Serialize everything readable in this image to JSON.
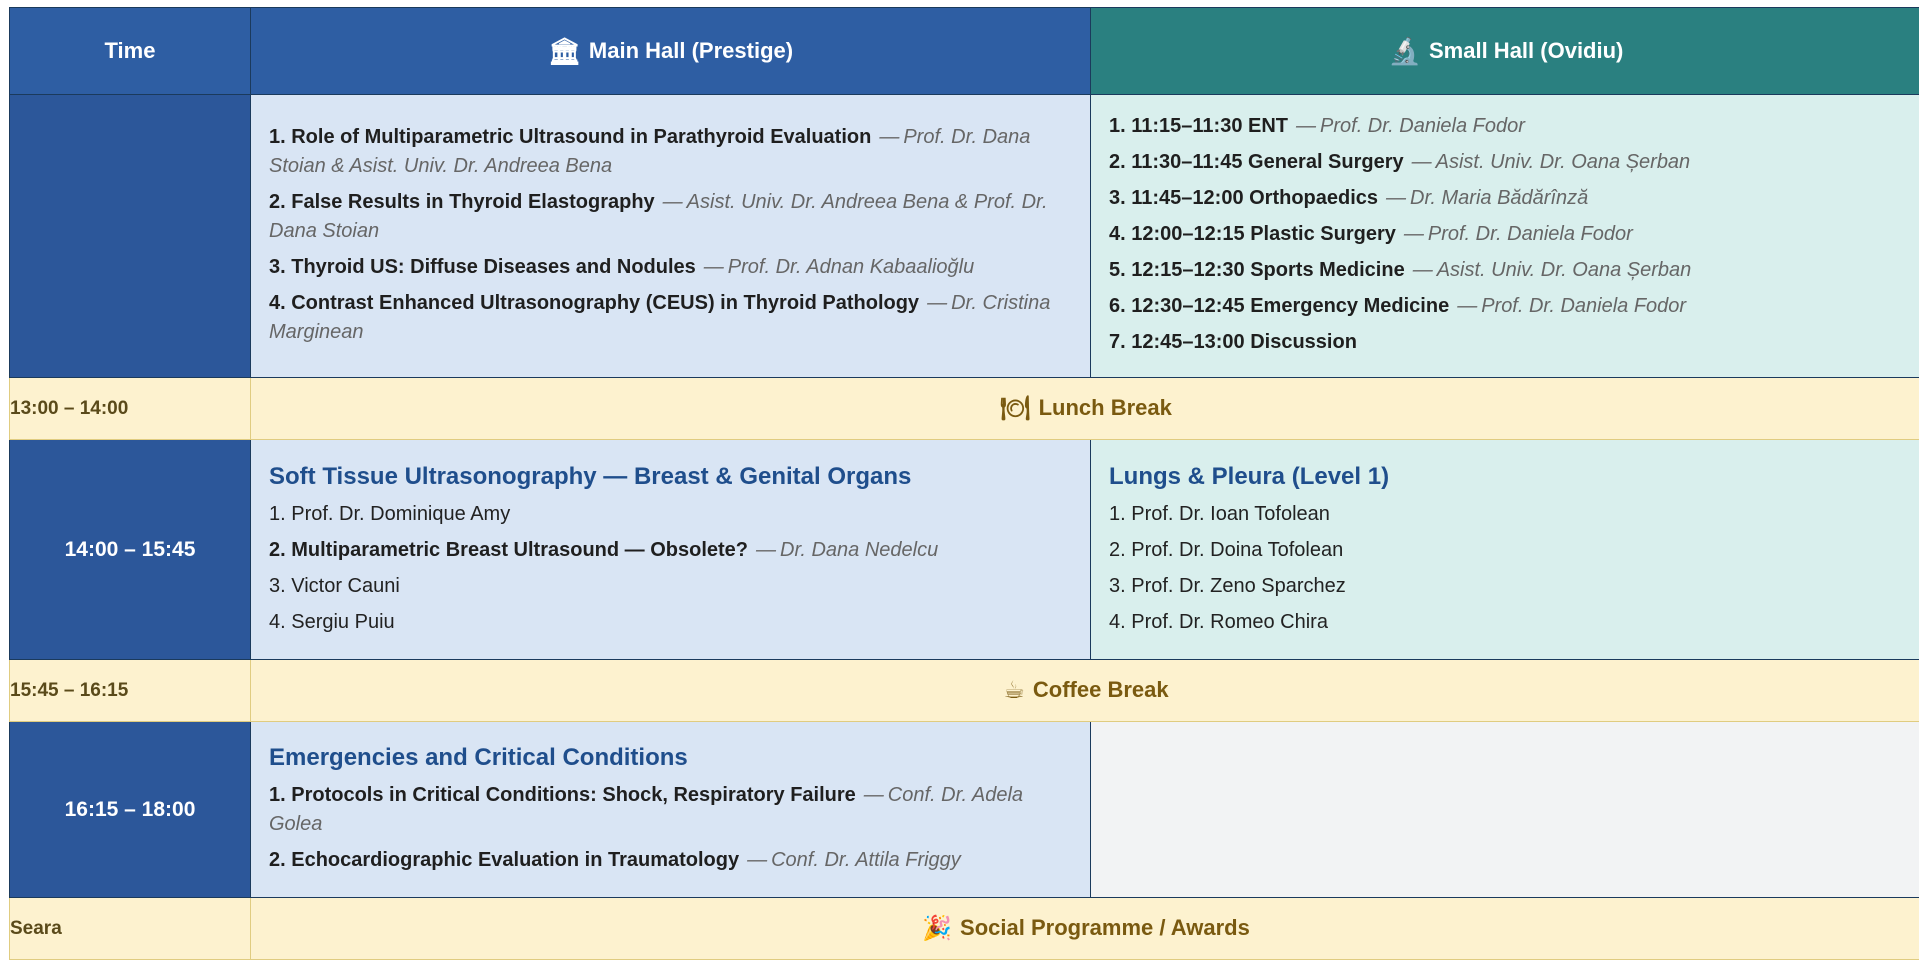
{
  "header": {
    "time_label": "Time",
    "main_hall_icon": "classical-building-icon",
    "main_hall_label": "Main Hall (Prestige)",
    "small_hall_icon": "microscope-icon",
    "small_hall_label": "Small Hall (Ovidiu)"
  },
  "block1": {
    "time": "",
    "main": [
      {
        "title": "1. Role of Multiparametric Ultrasound in Parathyroid Evaluation",
        "speaker": "Prof. Dr. Dana Stoian & Asist. Univ. Dr. Andreea Bena"
      },
      {
        "title": "2. False Results in Thyroid Elastography",
        "speaker": "Asist. Univ. Dr. Andreea Bena & Prof. Dr. Dana Stoian"
      },
      {
        "title": "3. Thyroid US: Diffuse Diseases and Nodules",
        "speaker": "Prof. Dr. Adnan Kabaalioğlu"
      },
      {
        "title": "4. Contrast Enhanced Ultrasonography (CEUS) in Thyroid Pathology",
        "speaker": "Dr. Cristina Marginean"
      }
    ],
    "small": [
      {
        "title": "1. 11:15–11:30  ENT",
        "speaker": "Prof. Dr. Daniela Fodor"
      },
      {
        "title": "2. 11:30–11:45  General Surgery",
        "speaker": "Asist. Univ. Dr. Oana Șerban"
      },
      {
        "title": "3. 11:45–12:00  Orthopaedics",
        "speaker": "Dr. Maria Bădărînză"
      },
      {
        "title": "4. 12:00–12:15  Plastic Surgery",
        "speaker": "Prof. Dr. Daniela Fodor"
      },
      {
        "title": "5. 12:15–12:30  Sports Medicine",
        "speaker": "Asist. Univ. Dr. Oana Șerban"
      },
      {
        "title": "6. 12:30–12:45  Emergency Medicine",
        "speaker": "Prof. Dr. Daniela Fodor"
      },
      {
        "title": "7. 12:45–13:00  Discussion",
        "speaker": ""
      }
    ]
  },
  "lunch": {
    "time": "13:00 – 14:00",
    "icon": "plate-cutlery-icon",
    "label": "Lunch Break"
  },
  "block2": {
    "time": "14:00 – 15:45",
    "main_title": "Soft Tissue Ultrasonography — Breast & Genital Organs",
    "main": [
      {
        "plain": "1. Prof. Dr. Dominique Amy"
      },
      {
        "title": "2. Multiparametric Breast Ultrasound — Obsolete?",
        "speaker": "Dr. Dana Nedelcu"
      },
      {
        "plain": "3. Victor Cauni"
      },
      {
        "plain": "4. Sergiu Puiu"
      }
    ],
    "small_title": "Lungs & Pleura (Level 1)",
    "small": [
      "1. Prof. Dr. Ioan Tofolean",
      "2. Prof. Dr. Doina Tofolean",
      "3. Prof. Dr. Zeno Sparchez",
      "4. Prof. Dr. Romeo Chira"
    ]
  },
  "coffee": {
    "time": "15:45 – 16:15",
    "icon": "coffee-cup-icon",
    "label": "Coffee Break"
  },
  "block3": {
    "time": "16:15 – 18:00",
    "main_title": "Emergencies and Critical Conditions",
    "main": [
      {
        "title": "1. Protocols in Critical Conditions: Shock, Respiratory Failure",
        "speaker": "Conf. Dr. Adela Golea"
      },
      {
        "title": "2. Echocardiographic Evaluation in Traumatology",
        "speaker": "Conf. Dr. Attila Friggy"
      }
    ]
  },
  "evening": {
    "time": "Seara",
    "icon": "party-popper-icon",
    "label": "Social Programme / Awards"
  },
  "separator": "—"
}
